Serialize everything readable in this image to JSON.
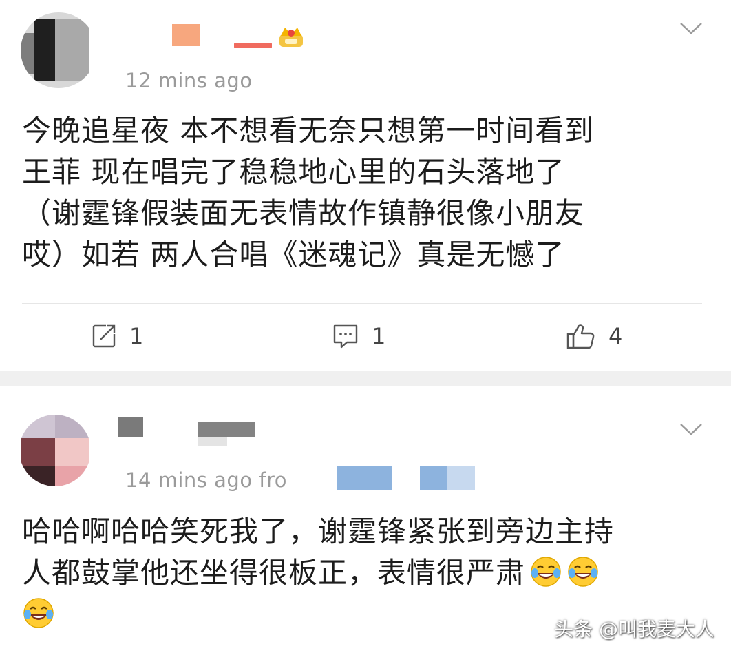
{
  "comments": [
    {
      "time": "12 mins ago",
      "lines": [
        "今晚追星夜 本不想看无奈只想第一时间看到",
        "王菲 现在唱完了稳稳地心里的石头落地了",
        "（谢霆锋假装面无表情故作镇静很像小朋友",
        "哎）如若 两人合唱《迷魂记》真是无憾了"
      ],
      "repost_count": "1",
      "comment_count": "1",
      "like_count": "4"
    },
    {
      "time": "14 mins ago  fro",
      "lines": [
        "哈哈啊哈哈笑死我了，谢霆锋紧张到旁边主持",
        "人都鼓掌他还坐得很板正，表情很严肃"
      ],
      "emoji": "laugh-cry-emoji"
    }
  ],
  "watermark": "头条 @叫我麦大人",
  "colors": {
    "time_gray": "#9a9a9a",
    "divider": "#e6e6e6",
    "gap": "#f0f0f0"
  }
}
